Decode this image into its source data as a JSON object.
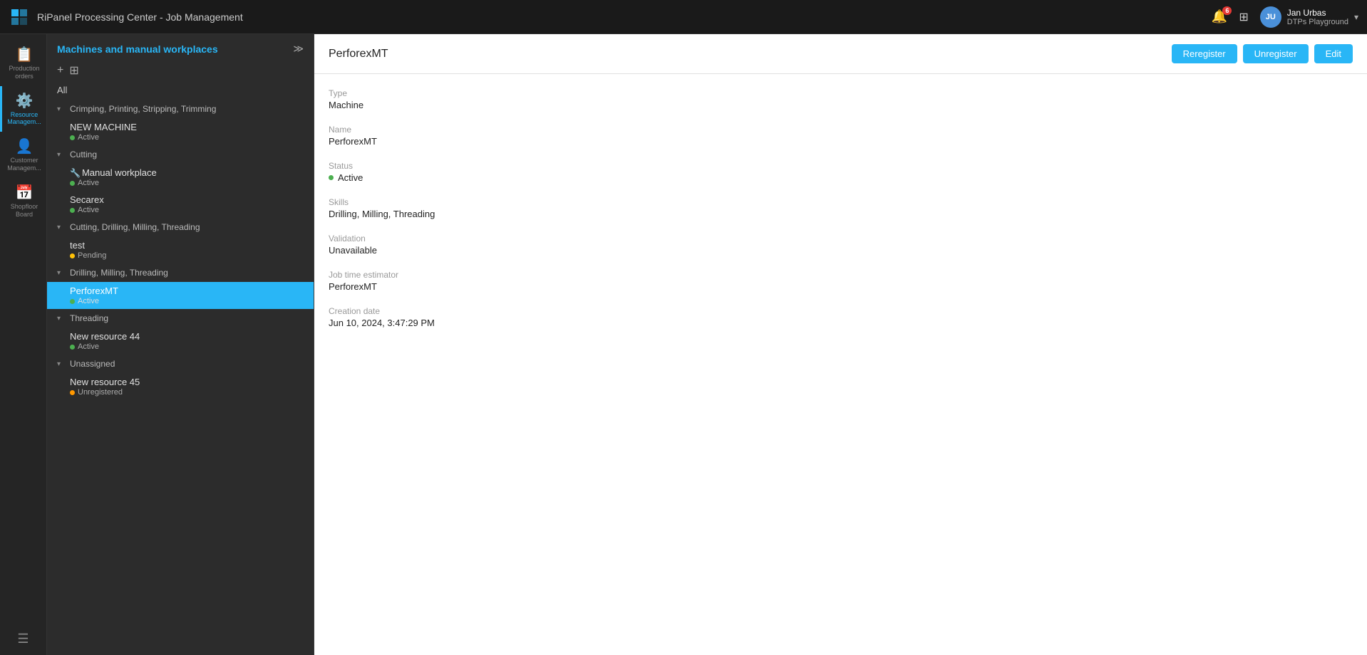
{
  "topbar": {
    "title": "RiPanel Processing Center - Job Management",
    "notification_count": "6",
    "user_initials": "JU",
    "user_name": "Jan Urbas",
    "user_org": "DTPs Playground"
  },
  "nav": {
    "items": [
      {
        "id": "production-orders",
        "label": "Production orders",
        "icon": "📋",
        "active": false
      },
      {
        "id": "resource-management",
        "label": "Resource Managem...",
        "icon": "⚙️",
        "active": true
      },
      {
        "id": "customer-management",
        "label": "Customer Managem...",
        "icon": "👤",
        "active": false
      },
      {
        "id": "shopfloor-board",
        "label": "Shopfloor Board",
        "icon": "📅",
        "active": false
      }
    ],
    "hamburger_label": "☰"
  },
  "sidebar": {
    "title": "Machines and manual workplaces",
    "add_label": "+",
    "import_label": "⊞",
    "all_label": "All",
    "tree": [
      {
        "id": "group-crimping",
        "label": "Crimping, Printing, Stripping, Trimming",
        "expanded": true,
        "items": [
          {
            "id": "new-machine",
            "name": "NEW MACHINE",
            "status": "Active",
            "dot": "green",
            "selected": false
          }
        ]
      },
      {
        "id": "group-cutting",
        "label": "Cutting",
        "expanded": true,
        "items": [
          {
            "id": "manual-workplace",
            "name": "Manual workplace",
            "status": "Active",
            "dot": "green",
            "selected": false,
            "icon": "🔧"
          },
          {
            "id": "secarex",
            "name": "Secarex",
            "status": "Active",
            "dot": "green",
            "selected": false
          }
        ]
      },
      {
        "id": "group-cutting-drilling",
        "label": "Cutting, Drilling, Milling, Threading",
        "expanded": true,
        "items": [
          {
            "id": "test",
            "name": "test",
            "status": "Pending",
            "dot": "yellow",
            "selected": false
          }
        ]
      },
      {
        "id": "group-drilling-milling",
        "label": "Drilling, Milling, Threading",
        "expanded": true,
        "items": [
          {
            "id": "perforexmt",
            "name": "PerforexMT",
            "status": "Active",
            "dot": "green",
            "selected": true
          }
        ]
      },
      {
        "id": "group-threading",
        "label": "Threading",
        "expanded": true,
        "items": [
          {
            "id": "new-resource-44",
            "name": "New resource 44",
            "status": "Active",
            "dot": "green",
            "selected": false
          }
        ]
      },
      {
        "id": "group-unassigned",
        "label": "Unassigned",
        "expanded": true,
        "items": [
          {
            "id": "new-resource-45",
            "name": "New resource 45",
            "status": "Unregistered",
            "dot": "orange",
            "selected": false
          }
        ]
      }
    ]
  },
  "content": {
    "title": "PerforexMT",
    "actions": {
      "reregister": "Reregister",
      "unregister": "Unregister",
      "edit": "Edit"
    },
    "fields": [
      {
        "id": "type",
        "label": "Type",
        "value": "Machine"
      },
      {
        "id": "name",
        "label": "Name",
        "value": "PerforexMT"
      },
      {
        "id": "status",
        "label": "Status",
        "value": "Active",
        "dot": "green"
      },
      {
        "id": "skills",
        "label": "Skills",
        "value": "Drilling, Milling, Threading"
      },
      {
        "id": "validation",
        "label": "Validation",
        "value": "Unavailable"
      },
      {
        "id": "job-time-estimator",
        "label": "Job time estimator",
        "value": "PerforexMT"
      },
      {
        "id": "creation-date",
        "label": "Creation date",
        "value": "Jun 10, 2024, 3:47:29 PM"
      }
    ]
  }
}
